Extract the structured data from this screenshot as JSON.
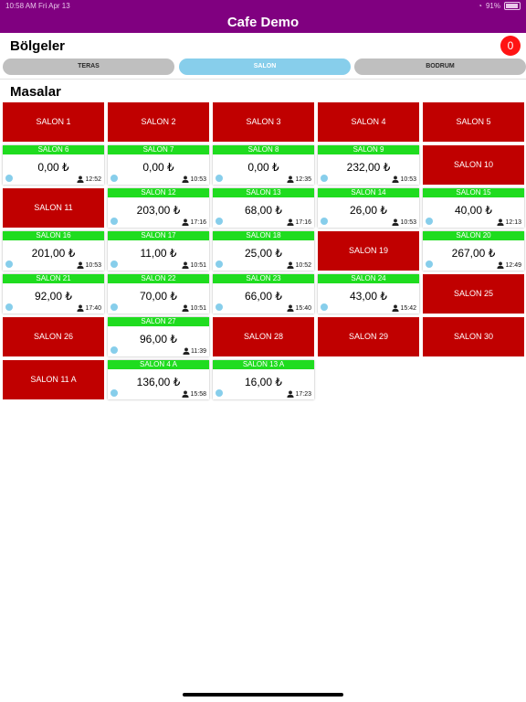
{
  "status_bar": {
    "time_date": "10:58 AM   Fri Apr 13",
    "battery": "91%"
  },
  "app": {
    "title": "Cafe Demo"
  },
  "regions": {
    "title": "Bölgeler",
    "badge": "0",
    "tabs": [
      {
        "label": "TERAS",
        "active": false
      },
      {
        "label": "SALON",
        "active": true
      },
      {
        "label": "BODRUM",
        "active": false
      }
    ]
  },
  "tables": {
    "title": "Masalar",
    "items": [
      {
        "name": "SALON 1",
        "status": "empty"
      },
      {
        "name": "SALON 2",
        "status": "empty"
      },
      {
        "name": "SALON 3",
        "status": "empty"
      },
      {
        "name": "SALON 4",
        "status": "empty"
      },
      {
        "name": "SALON 5",
        "status": "empty"
      },
      {
        "name": "SALON 6",
        "status": "occupied",
        "amount": "0,00 ₺",
        "time": "12:52"
      },
      {
        "name": "SALON 7",
        "status": "occupied",
        "amount": "0,00 ₺",
        "time": "10:53"
      },
      {
        "name": "SALON 8",
        "status": "occupied",
        "amount": "0,00 ₺",
        "time": "12:35"
      },
      {
        "name": "SALON 9",
        "status": "occupied",
        "amount": "232,00 ₺",
        "time": "10:53"
      },
      {
        "name": "SALON 10",
        "status": "empty"
      },
      {
        "name": "SALON 11",
        "status": "empty"
      },
      {
        "name": "SALON 12",
        "status": "occupied",
        "amount": "203,00 ₺",
        "time": "17:16"
      },
      {
        "name": "SALON 13",
        "status": "occupied",
        "amount": "68,00 ₺",
        "time": "17:16"
      },
      {
        "name": "SALON 14",
        "status": "occupied",
        "amount": "26,00 ₺",
        "time": "10:53"
      },
      {
        "name": "SALON 15",
        "status": "occupied",
        "amount": "40,00 ₺",
        "time": "12:13"
      },
      {
        "name": "SALON 16",
        "status": "occupied",
        "amount": "201,00 ₺",
        "time": "10:53"
      },
      {
        "name": "SALON 17",
        "status": "occupied",
        "amount": "11,00 ₺",
        "time": "10:51"
      },
      {
        "name": "SALON 18",
        "status": "occupied",
        "amount": "25,00 ₺",
        "time": "10:52"
      },
      {
        "name": "SALON 19",
        "status": "empty"
      },
      {
        "name": "SALON 20",
        "status": "occupied",
        "amount": "267,00 ₺",
        "time": "12:49"
      },
      {
        "name": "SALON 21",
        "status": "occupied",
        "amount": "92,00 ₺",
        "time": "17:40"
      },
      {
        "name": "SALON 22",
        "status": "occupied",
        "amount": "70,00 ₺",
        "time": "10:51"
      },
      {
        "name": "SALON 23",
        "status": "occupied",
        "amount": "66,00 ₺",
        "time": "15:40"
      },
      {
        "name": "SALON 24",
        "status": "occupied",
        "amount": "43,00 ₺",
        "time": "15:42"
      },
      {
        "name": "SALON 25",
        "status": "empty"
      },
      {
        "name": "SALON 26",
        "status": "empty"
      },
      {
        "name": "SALON 27",
        "status": "occupied",
        "amount": "96,00 ₺",
        "time": "11:39"
      },
      {
        "name": "SALON 28",
        "status": "empty"
      },
      {
        "name": "SALON 29",
        "status": "empty"
      },
      {
        "name": "SALON 30",
        "status": "empty"
      },
      {
        "name": "SALON 11 A",
        "status": "empty"
      },
      {
        "name": "SALON 4 A",
        "status": "occupied",
        "amount": "136,00 ₺",
        "time": "15:58"
      },
      {
        "name": "SALON 13 A",
        "status": "occupied",
        "amount": "16,00 ₺",
        "time": "17:23"
      }
    ]
  },
  "colors": {
    "header": "#800080",
    "empty_table": "#c00000",
    "occupied_header": "#1fdc1f",
    "active_tab": "#87ceeb",
    "badge": "#ff1414"
  }
}
